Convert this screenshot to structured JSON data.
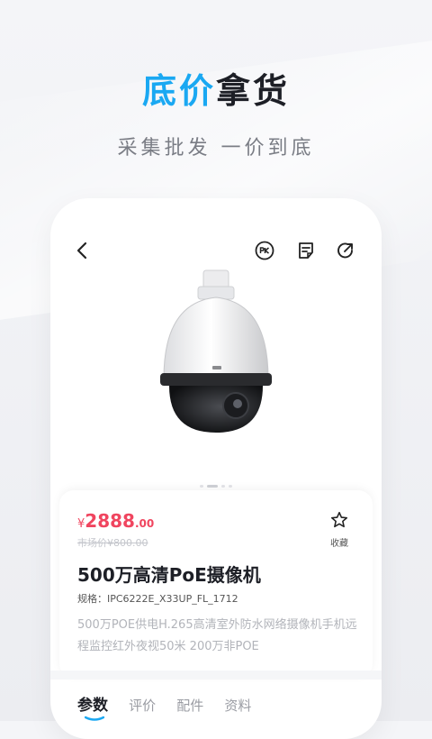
{
  "promo": {
    "title_highlight": "底价",
    "title_rest": "拿货",
    "subtitle": "采集批发 一价到底"
  },
  "icons": {
    "back": "back-arrow-icon",
    "pk": "pk-icon",
    "note": "note-icon",
    "share": "share-icon",
    "favorite": "star-icon"
  },
  "product": {
    "currency": "¥",
    "price_int": "2888",
    "price_dec": ".00",
    "original_price": "市场价¥800.00",
    "favorite_label": "收藏",
    "title": "500万高清PoE摄像机",
    "spec_label": "规格：",
    "spec_value": "IPC6222E_X33UP_FL_1712",
    "description": "500万POE供电H.265高清室外防水网络摄像机手机远程监控红外夜视50米 200万非POE",
    "image_dots": {
      "count": 4,
      "active": 1
    }
  },
  "tabs": [
    {
      "label": "参数",
      "active": true
    },
    {
      "label": "评价",
      "active": false
    },
    {
      "label": "配件",
      "active": false
    },
    {
      "label": "资料",
      "active": false
    }
  ],
  "colors": {
    "accent": "#1aa8f2",
    "price": "#f0455f"
  }
}
